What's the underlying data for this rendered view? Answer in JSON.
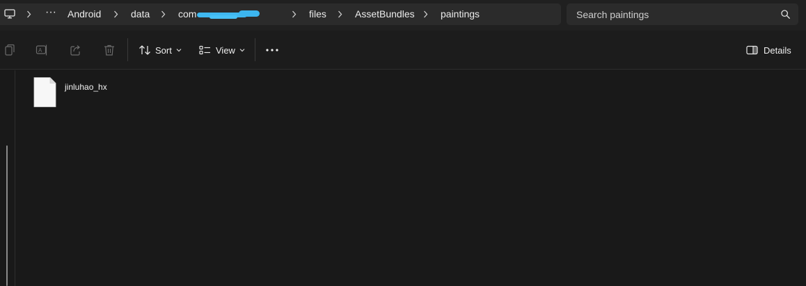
{
  "address_bar": {
    "overflow": "···",
    "crumbs": [
      "Android",
      "data",
      "com",
      "files",
      "AssetBundles",
      "paintings"
    ]
  },
  "search": {
    "placeholder": "Search paintings"
  },
  "command_bar": {
    "sort_label": "Sort",
    "view_label": "View",
    "more_label": "···",
    "details_label": "Details"
  },
  "files": [
    {
      "name": "jinluhao_hx",
      "icon": "blank-file-icon"
    }
  ],
  "colors": {
    "background": "#191919",
    "bar": "#2b2b2b",
    "redaction": "#3fb8f0"
  }
}
